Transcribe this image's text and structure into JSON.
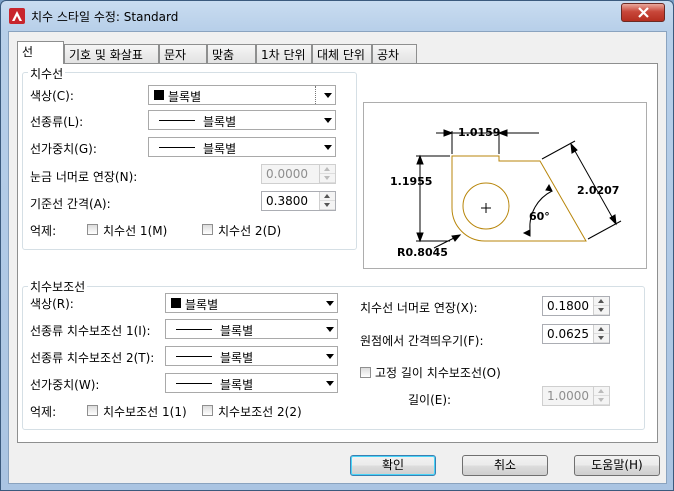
{
  "window": {
    "title": "치수 스타일 수정: Standard"
  },
  "tabs": [
    {
      "label": "선",
      "active": true
    },
    {
      "label": "기호 및 화살표"
    },
    {
      "label": "문자"
    },
    {
      "label": "맞춤"
    },
    {
      "label": "1차 단위"
    },
    {
      "label": "대체 단위"
    },
    {
      "label": "공차"
    }
  ],
  "dimlines": {
    "group_label": "치수선",
    "color_label": "색상(C):",
    "color_value": "블록별",
    "linetype_label": "선종류(L):",
    "linetype_value": "블록별",
    "lineweight_label": "선가중치(G):",
    "lineweight_value": "블록별",
    "extend_label": "눈금 너머로 연장(N):",
    "extend_value": "0.0000",
    "baseline_label": "기준선 간격(A):",
    "baseline_value": "0.3800",
    "suppress_label": "억제:",
    "suppress1_label": "치수선 1(M)",
    "suppress2_label": "치수선 2(D)"
  },
  "extlines": {
    "group_label": "치수보조선",
    "color_label": "색상(R):",
    "color_value": "블록별",
    "lt1_label": "선종류 치수보조선 1(I):",
    "lt1_value": "블록별",
    "lt2_label": "선종류 치수보조선 2(T):",
    "lt2_value": "블록별",
    "lineweight_label": "선가중치(W):",
    "lineweight_value": "블록별",
    "suppress_label": "억제:",
    "suppress1_label": "치수보조선 1(1)",
    "suppress2_label": "치수보조선 2(2)",
    "beyond_label": "치수선 너머로 연장(X):",
    "beyond_value": "0.1800",
    "offset_label": "원점에서 간격띄우기(F):",
    "offset_value": "0.0625",
    "fixed_label": "고정 길이 치수보조선(O)",
    "length_label": "길이(E):",
    "length_value": "1.0000"
  },
  "preview": {
    "dim_top": "1.0159",
    "dim_left": "1.1955",
    "dim_right": "2.0207",
    "angle": "60°",
    "radius": "R0.8045",
    "center_mark": "+"
  },
  "buttons": {
    "ok": "확인",
    "cancel": "취소",
    "help": "도움말(H)"
  }
}
